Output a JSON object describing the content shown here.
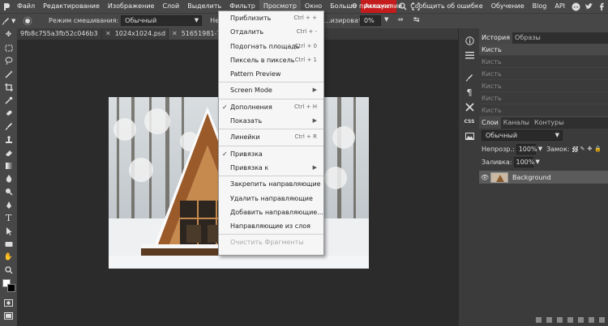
{
  "menubar": {
    "items": [
      "Файл",
      "Редактирование",
      "Изображение",
      "Слой",
      "Выделить",
      "Фильтр",
      "Просмотр",
      "Окно",
      "Больше",
      "Аккаунт"
    ],
    "right_links": [
      "О приложении",
      "Сообщить об ошибке",
      "Обучение",
      "Blog",
      "API"
    ],
    "icons": [
      "search-icon",
      "fullscreen-icon",
      "reddit-icon",
      "twitter-icon",
      "facebook-icon"
    ]
  },
  "options": {
    "blend_label": "Режим смешивания:",
    "blend_value": "Обычный",
    "opacity_label": "Непрозр.:",
    "smooth_label": "...изировать:",
    "smooth_value": "0%"
  },
  "tabs": [
    {
      "label": "9fb8c755a3fb52c046b3"
    },
    {
      "label": "1024x1024.psd *"
    },
    {
      "label": "51651981-77936"
    }
  ],
  "view_menu": [
    {
      "label": "Приблизить",
      "shortcut": "Ctrl + +"
    },
    {
      "label": "Отдалить",
      "shortcut": "Ctrl + -"
    },
    {
      "label": "Подогнать площадь",
      "shortcut": "Ctrl + 0"
    },
    {
      "label": "Пиксель в пиксель",
      "shortcut": "Ctrl + 1"
    },
    {
      "label": "Pattern Preview",
      "shortcut": ""
    },
    {
      "sep": true
    },
    {
      "label": "Screen Mode",
      "arrow": true
    },
    {
      "sep": true
    },
    {
      "label": "Дополнения",
      "shortcut": "Ctrl + H",
      "checked": true
    },
    {
      "label": "Показать",
      "arrow": true
    },
    {
      "sep": true
    },
    {
      "label": "Линейки",
      "shortcut": "Ctrl + R"
    },
    {
      "sep": true
    },
    {
      "label": "Привязка",
      "checked": true
    },
    {
      "label": "Привязка к",
      "arrow": true
    },
    {
      "sep": true
    },
    {
      "label": "Закрепить направляющие"
    },
    {
      "label": "Удалить направляющие"
    },
    {
      "label": "Добавить направляющие..."
    },
    {
      "label": "Направляющие из слоя"
    },
    {
      "sep": true
    },
    {
      "label": "Очистить Фрагменты",
      "disabled": true
    }
  ],
  "history": {
    "tabs": [
      "История",
      "Образы"
    ],
    "rows": [
      "Кисть",
      "Кисть",
      "Кисть",
      "Кисть",
      "Кисть",
      "Кисть"
    ]
  },
  "layers": {
    "tabs": [
      "Слои",
      "Каналы",
      "Контуры"
    ],
    "blend": "Обычный",
    "opacity_label": "Непрозр.:",
    "opacity": "100%",
    "lock_label": "Замок:",
    "fill_label": "Заливка:",
    "fill": "100%",
    "layer_name": "Background"
  },
  "iconstrip": {
    "css_label": "CSS"
  }
}
